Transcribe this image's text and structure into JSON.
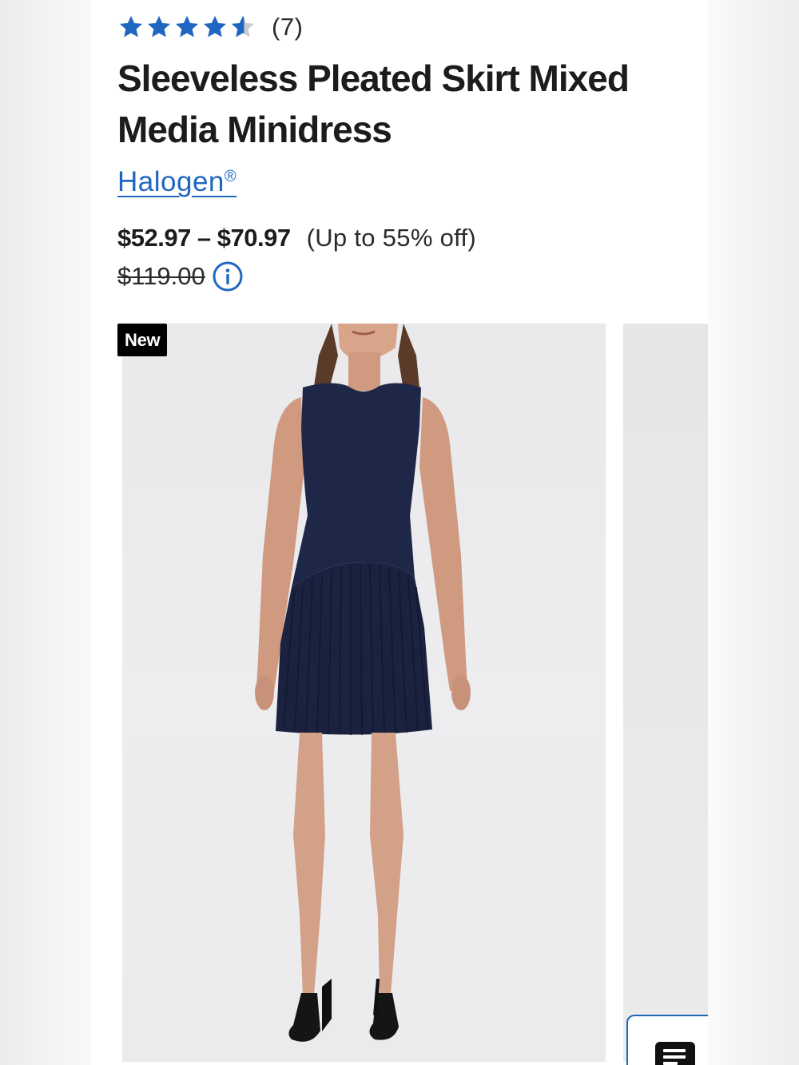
{
  "product": {
    "rating": {
      "value": 4.5,
      "max": 5,
      "count_text": "(7)"
    },
    "title": "Sleeveless Pleated Skirt Mixed Media Minidress",
    "brand": "Halogen",
    "brand_mark": "®",
    "price_range": "$52.97 – $70.97",
    "discount_text": "(Up to 55% off)",
    "original_price": "$119.00",
    "badge": "New"
  },
  "colors": {
    "star": "#1f66c1",
    "link": "#1f66c1",
    "dress": "#1e2747",
    "badge_bg": "#000000"
  },
  "icons": {
    "info": "info-circle-icon",
    "chat": "chat-icon",
    "star": "star-icon"
  }
}
